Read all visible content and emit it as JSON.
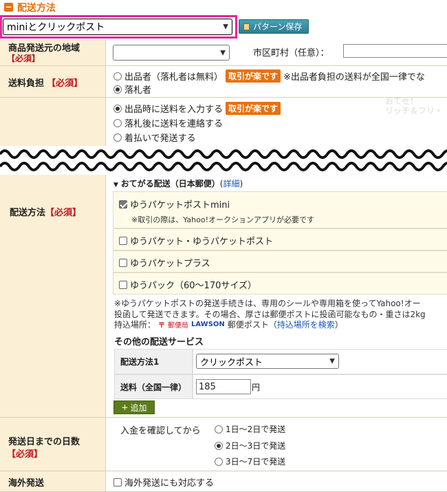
{
  "section": {
    "title": "配送方法",
    "collapse_icon": "minus-icon"
  },
  "pattern": {
    "selected": "miniとクリックポスト",
    "save_label": "パターン保存",
    "save_icon": "floppy-icon"
  },
  "origin": {
    "label": "商品発送元の地域",
    "required": "【必須】",
    "city_label": "市区町村（任意）："
  },
  "burden": {
    "label": "送料負担",
    "required": "【必須】",
    "opt1": "出品者（落札者は無料）",
    "badge": "取引が楽です",
    "note": "※出品者負担の送料が全国一律でな",
    "opt2": "落札者"
  },
  "method_opts": {
    "opt1": "出品時に送料を入力する",
    "badge": "取引が楽です",
    "opt2": "落札後に送料を連絡する",
    "opt3": "着払いで発送する",
    "watermark": "ラ<wbr>ク<wbr>な<wbr>う<wbr>リッチ＆フリ"
  },
  "method": {
    "label": "配送方法",
    "required": "【必須】",
    "otegaru_title": "おてがる配送（日本郵便）",
    "otegaru_link": "詳細",
    "options": [
      {
        "label": "ゆうパケットポストmini",
        "checked": true,
        "sub": "※取引の際は、Yahoo!オークションアプリが必要です"
      },
      {
        "label": "ゆうパケット・ゆうパケットポスト",
        "checked": false
      },
      {
        "label": "ゆうパケットプラス",
        "checked": false
      },
      {
        "label": "ゆうパック（60〜170サイズ）",
        "checked": false
      }
    ],
    "note_line1": "※ゆうパケットポストの発送手続きは、専用のシールや専用箱を使ってYahoo!オー",
    "note_line2": "投函して発送できます。その場合、厚さは郵便ポストに投函可能なもの・重さは2kg",
    "carry_label": "持込場所：",
    "jp_logo": "郵便局",
    "lawson_logo": "LAWSON",
    "post_text": "郵便ポスト（",
    "carry_link": "持込場所を検索",
    "post_close": "）",
    "other_title": "その他の配送サービス",
    "svc_label": "配送方法1",
    "svc_value": "クリックポスト",
    "fee_label": "送料（全国一律）",
    "fee_value": "185",
    "fee_unit": "円",
    "add_label": "追加"
  },
  "days": {
    "label": "発送日までの日数",
    "required": "【必須】",
    "prefix": "入金を確認してから",
    "options": [
      {
        "label": "1日〜2日で発送",
        "selected": false
      },
      {
        "label": "2日〜3日で発送",
        "selected": true
      },
      {
        "label": "3日〜7日で発送",
        "selected": false
      }
    ]
  },
  "overseas": {
    "label": "海外発送",
    "option": "海外発送にも対応する"
  }
}
